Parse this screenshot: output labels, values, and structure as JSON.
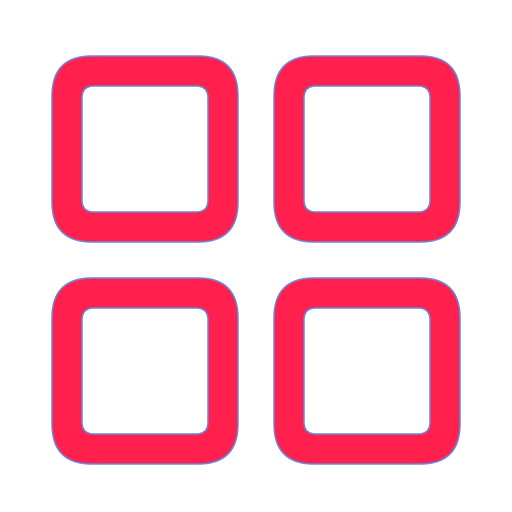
{
  "icon": {
    "name": "grid-icon",
    "fill_color": "#ff204e",
    "outline_color": "#6d86d8",
    "background_color": "#ffffff",
    "cells": [
      {
        "name": "grid-cell-top-left"
      },
      {
        "name": "grid-cell-top-right"
      },
      {
        "name": "grid-cell-bottom-left"
      },
      {
        "name": "grid-cell-bottom-right"
      }
    ]
  }
}
